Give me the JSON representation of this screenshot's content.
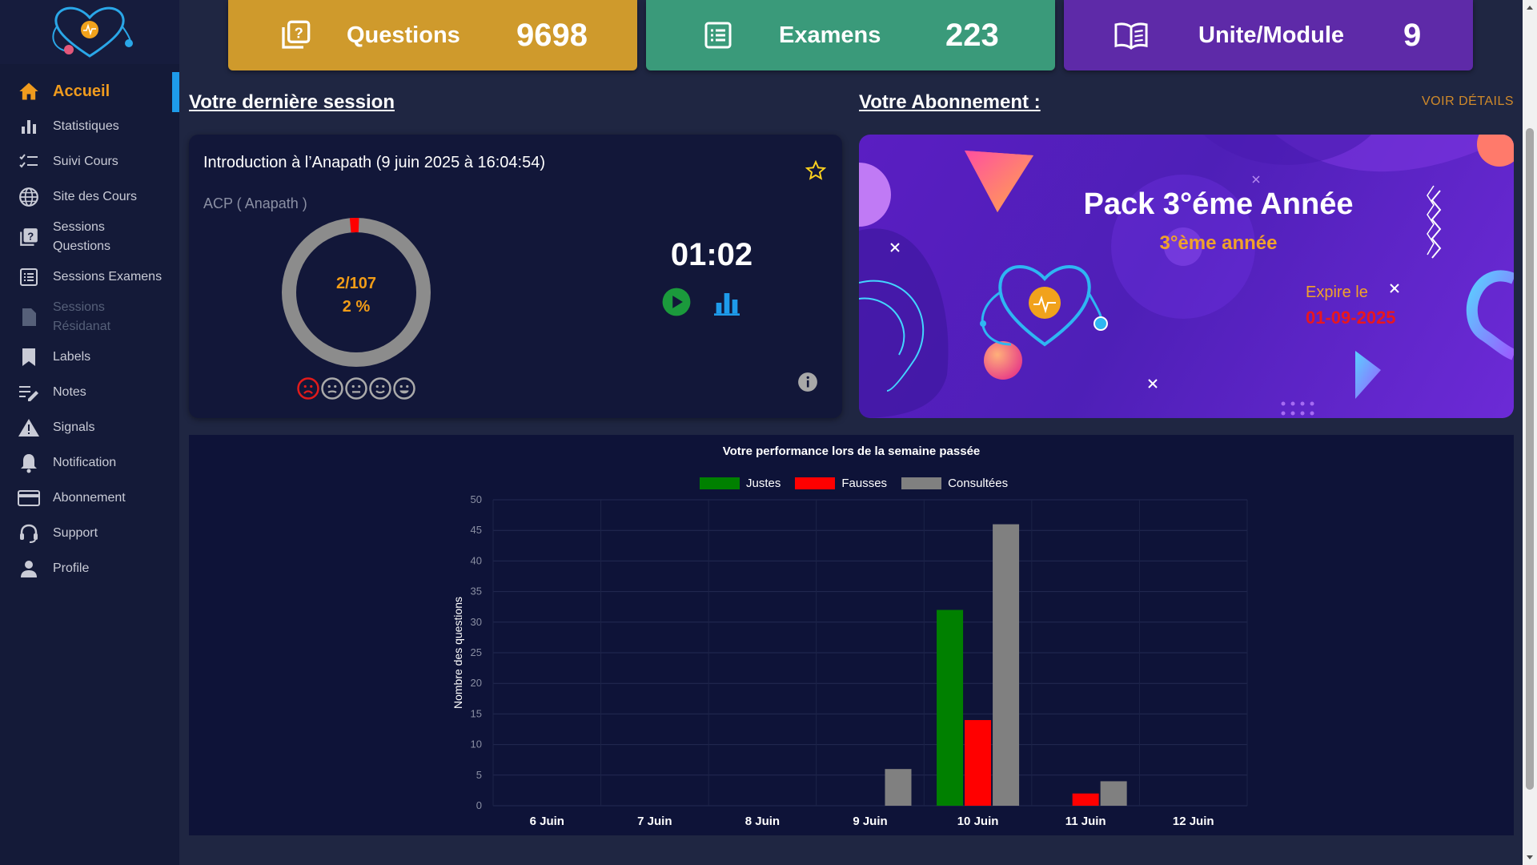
{
  "stats": [
    {
      "label": "Questions",
      "value": "9698",
      "color": "#cf9a2c"
    },
    {
      "label": "Examens",
      "value": "223",
      "color": "#3a9a7a"
    },
    {
      "label": "Unite/Module",
      "value": "9",
      "color": "#5e2aa8"
    }
  ],
  "sidebar": {
    "items": [
      {
        "label": "Accueil",
        "icon": "home-icon"
      },
      {
        "label": "Statistiques",
        "icon": "bar-chart-icon"
      },
      {
        "label": "Suivi Cours",
        "icon": "checklist-icon"
      },
      {
        "label": "Site des Cours",
        "icon": "globe-icon"
      },
      {
        "label": "Sessions Questions",
        "icon": "question-book-icon"
      },
      {
        "label": "Sessions Examens",
        "icon": "list-icon"
      },
      {
        "label": "Sessions Résidanat",
        "icon": "document-icon"
      },
      {
        "label": "Labels",
        "icon": "bookmark-icon"
      },
      {
        "label": "Notes",
        "icon": "edit-notes-icon"
      },
      {
        "label": "Signals",
        "icon": "warning-icon"
      },
      {
        "label": "Notification",
        "icon": "bell-icon"
      },
      {
        "label": "Abonnement",
        "icon": "credit-card-icon"
      },
      {
        "label": "Support",
        "icon": "headset-icon"
      },
      {
        "label": "Profile",
        "icon": "person-icon"
      }
    ]
  },
  "session": {
    "heading": "Votre dernière session",
    "title": "Introduction à l’Anapath (9 juin 2025 à 16:04:54)",
    "module": "ACP ( Anapath )",
    "ratio": "2/107",
    "percent": "2 %",
    "progress": 0.02,
    "timer": "01:02"
  },
  "subscription": {
    "heading": "Votre Abonnement :",
    "details_link": "VOIR DÉTAILS",
    "pack": "Pack 3°éme Année",
    "year": "3°ème année",
    "expire_label": "Expire le",
    "expire_date": "01-09-2025"
  },
  "chart_data": {
    "type": "bar",
    "title": "Votre performance lors de la semaine passée",
    "ylabel": "Nombre des questions",
    "xlabel": "",
    "ylim": [
      0,
      50
    ],
    "yticks": [
      0,
      5,
      10,
      15,
      20,
      25,
      30,
      35,
      40,
      45,
      50
    ],
    "categories": [
      "6 Juin",
      "7 Juin",
      "8 Juin",
      "9 Juin",
      "10 Juin",
      "11 Juin",
      "12 Juin"
    ],
    "series": [
      {
        "name": "Justes",
        "color": "#008000",
        "values": [
          0,
          0,
          0,
          0,
          32,
          0,
          0
        ]
      },
      {
        "name": "Fausses",
        "color": "#ff0000",
        "values": [
          0,
          0,
          0,
          0,
          14,
          2,
          0
        ]
      },
      {
        "name": "Consultées",
        "color": "#808080",
        "values": [
          0,
          0,
          0,
          6,
          46,
          4,
          0
        ]
      }
    ],
    "legend": "top",
    "grid": true
  }
}
